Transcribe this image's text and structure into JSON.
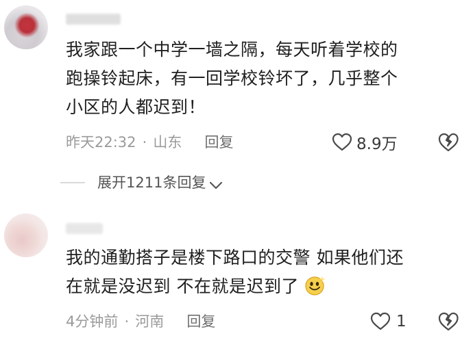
{
  "comments": [
    {
      "username": "",
      "text_line1": "我家跟一个中学一墙之隔，每天听着学校的",
      "text_line2": "跑操铃起床，有一回学校铃坏了，几乎整个",
      "text_line3": "小区的人都迟到！",
      "time": "昨天22:32",
      "separator": "·",
      "location": "山东",
      "reply_label": "回复",
      "likes": "8.9万"
    },
    {
      "username": "",
      "text_line1": "我的通勤搭子是楼下路口的交警 如果他们还",
      "text_line2": "在就是没迟到 不在就是迟到了",
      "emoji": "smile-emoji",
      "time": "4分钟前",
      "separator": "·",
      "location": "河南",
      "reply_label": "回复",
      "likes": "1"
    }
  ],
  "expand_replies_label": "展开1211条回复",
  "icons": {
    "like": "heart-outline-icon",
    "dislike": "broken-heart-icon",
    "expand": "chevron-down-icon"
  },
  "colors": {
    "text": "#1f1f1f",
    "meta": "#9a9a9a",
    "divider": "#d9d9d9"
  }
}
